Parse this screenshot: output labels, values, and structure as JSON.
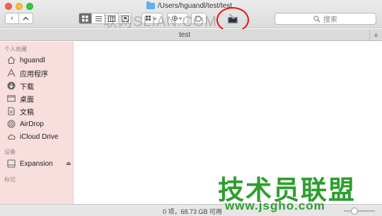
{
  "window": {
    "title": "/Users/hguandl/test/test",
    "nav_back": "‹",
    "nav_forward": "›",
    "search_placeholder": "搜索",
    "watermark_top": "联网SLIAN.COM",
    "tab_label": "test",
    "tab_add": "+"
  },
  "sidebar": {
    "section_favorites": "个人收藏",
    "favorites": [
      {
        "label": "hguandl",
        "icon": "home-icon"
      },
      {
        "label": "应用程序",
        "icon": "applications-icon"
      },
      {
        "label": "下载",
        "icon": "downloads-icon"
      },
      {
        "label": "桌面",
        "icon": "desktop-icon"
      },
      {
        "label": "文稿",
        "icon": "documents-icon"
      },
      {
        "label": "AirDrop",
        "icon": "airdrop-icon"
      },
      {
        "label": "iCloud Drive",
        "icon": "cloud-icon"
      }
    ],
    "section_devices": "设备",
    "devices": [
      {
        "label": "Expansion",
        "icon": "drive-icon",
        "eject": "⏏"
      }
    ],
    "section_tags": "标记"
  },
  "status": {
    "text": "0 项，68.73 GB 可用"
  },
  "watermark": {
    "brand": "技术员联盟",
    "url": "www.jsgho.com"
  },
  "colors": {
    "sidebar_bg": "#f9dede",
    "highlight": "#e11111",
    "watermark_green": "#2f9e2f"
  }
}
